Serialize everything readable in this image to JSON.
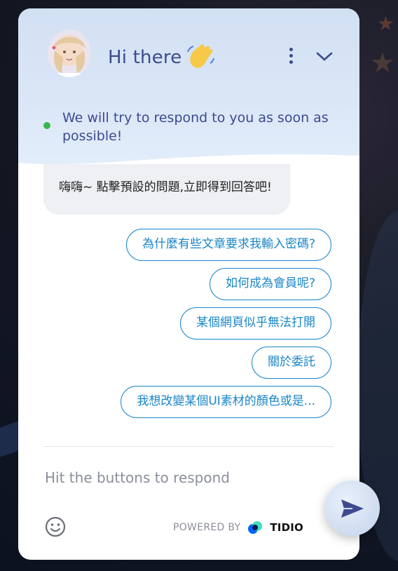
{
  "header": {
    "title": "Hi there",
    "status_text": "We will try to respond to you as soon as possible!",
    "status_color": "#39b54a",
    "accent_color": "#3d4a8f"
  },
  "message": {
    "text": "嗨嗨~ 點擊預設的問題,立即得到回答吧!"
  },
  "options": [
    {
      "label": "為什麼有些文章要求我輸入密碼?"
    },
    {
      "label": "如何成為會員呢?"
    },
    {
      "label": "某個網頁似乎無法打開"
    },
    {
      "label": "關於委託"
    },
    {
      "label": "我想改變某個UI素材的顏色或是..."
    }
  ],
  "composer": {
    "placeholder": "Hit the buttons to respond"
  },
  "footer": {
    "powered_by": "POWERED BY",
    "brand": "TIDIO"
  },
  "colors": {
    "option_border": "#1a86c7",
    "header_bg": "#d2e0f3"
  }
}
